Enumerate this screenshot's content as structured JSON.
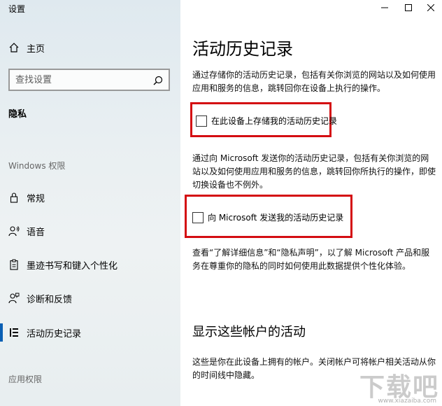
{
  "window": {
    "title": "设置"
  },
  "sidebar": {
    "home_label": "主页",
    "search": {
      "placeholder": "查找设置"
    },
    "section_title": "隐私",
    "windows_group": "Windows 权限",
    "items": [
      {
        "label": "常规",
        "icon": "lock-icon"
      },
      {
        "label": "语音",
        "icon": "speech-icon"
      },
      {
        "label": "墨迹书写和键入个性化",
        "icon": "pen-clipboard-icon"
      },
      {
        "label": "诊断和反馈",
        "icon": "feedback-icon"
      },
      {
        "label": "活动历史记录",
        "icon": "activity-history-icon"
      }
    ],
    "app_group": "应用权限"
  },
  "main": {
    "title": "活动历史记录",
    "para1": "通过存储你的活动历史记录，包括有关你浏览的网站以及如何使用应用和服务的信息，跳转回你在设备上执行的操作。",
    "checkbox1": {
      "label": "在此设备上存储我的活动历史记录",
      "checked": false
    },
    "para2": "通过向 Microsoft 发送你的活动历史记录，包括有关你浏览的网站以及如何使用应用和服务的信息，跳转回你所执行的操作，即使切换设备也不例外。",
    "checkbox2": {
      "label": "向 Microsoft 发送我的活动历史记录",
      "checked": false
    },
    "para3": "查看“了解详细信息”和“隐私声明”，以了解 Microsoft 产品和服务在尊重你的隐私的同时如何使用此数据提供个性化体验。",
    "subtitle": "显示这些帐户的活动",
    "para4": "这些是你在此设备上拥有的帐户。关闭帐户可将帐户相关活动从你的时间线中隐藏。"
  },
  "watermark": {
    "text": "下载吧",
    "url": "www.xiazaiba.com"
  },
  "colors": {
    "highlight": "#d40d12",
    "accent": "#0a5fb4"
  }
}
